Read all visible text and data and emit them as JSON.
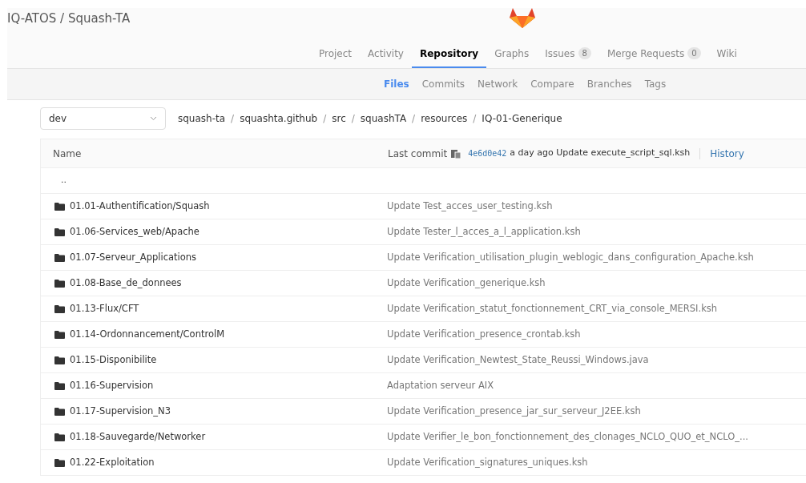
{
  "project_title": "IQ-ATOS / Squash-TA",
  "nav_tabs": [
    {
      "label": "Project",
      "selected": false
    },
    {
      "label": "Activity",
      "selected": false
    },
    {
      "label": "Repository",
      "selected": true
    },
    {
      "label": "Graphs",
      "selected": false
    },
    {
      "label": "Issues",
      "count": "8",
      "selected": false
    },
    {
      "label": "Merge Requests",
      "count": "0",
      "selected": false
    },
    {
      "label": "Wiki",
      "selected": false
    }
  ],
  "sub_tabs": [
    {
      "label": "Files",
      "selected": true
    },
    {
      "label": "Commits",
      "selected": false
    },
    {
      "label": "Network",
      "selected": false
    },
    {
      "label": "Compare",
      "selected": false
    },
    {
      "label": "Branches",
      "selected": false
    },
    {
      "label": "Tags",
      "selected": false
    }
  ],
  "branch": "dev",
  "breadcrumb_separator": "/",
  "breadcrumb": [
    "squash-ta",
    "squashta.github",
    "src",
    "squashTA",
    "resources",
    "IQ-01-Generique"
  ],
  "table": {
    "name_heading": "Name",
    "last_commit_label": "Last commit",
    "commit_hash": "4e6d0e42",
    "commit_info": "a day ago Update execute_script_sql.ksh",
    "history_link": "History",
    "parent_row": "..",
    "rows": [
      {
        "name": "01.01-Authentification/Squash",
        "message": "Update Test_acces_user_testing.ksh"
      },
      {
        "name": "01.06-Services_web/Apache",
        "message": "Update Tester_l_acces_a_l_application.ksh"
      },
      {
        "name": "01.07-Serveur_Applications",
        "message": "Update Verification_utilisation_plugin_weblogic_dans_configuration_Apache.ksh"
      },
      {
        "name": "01.08-Base_de_donnees",
        "message": "Update Verification_generique.ksh"
      },
      {
        "name": "01.13-Flux/CFT",
        "message": "Update Verification_statut_fonctionnement_CRT_via_console_MERSI.ksh"
      },
      {
        "name": "01.14-Ordonnancement/ControlM",
        "message": "Update Verification_presence_crontab.ksh"
      },
      {
        "name": "01.15-Disponibilite",
        "message": "Update Verification_Newtest_State_Reussi_Windows.java"
      },
      {
        "name": "01.16-Supervision",
        "message": "Adaptation serveur AIX"
      },
      {
        "name": "01.17-Supervision_N3",
        "message": "Update Verification_presence_jar_sur_serveur_J2EE.ksh"
      },
      {
        "name": "01.18-Sauvegarde/Networker",
        "message": "Update Verifier_le_bon_fonctionnement_des_clonages_NCLO_QUO_et_NCLO_..."
      },
      {
        "name": "01.22-Exploitation",
        "message": "Update Verification_signatures_uniques.ksh"
      }
    ]
  }
}
